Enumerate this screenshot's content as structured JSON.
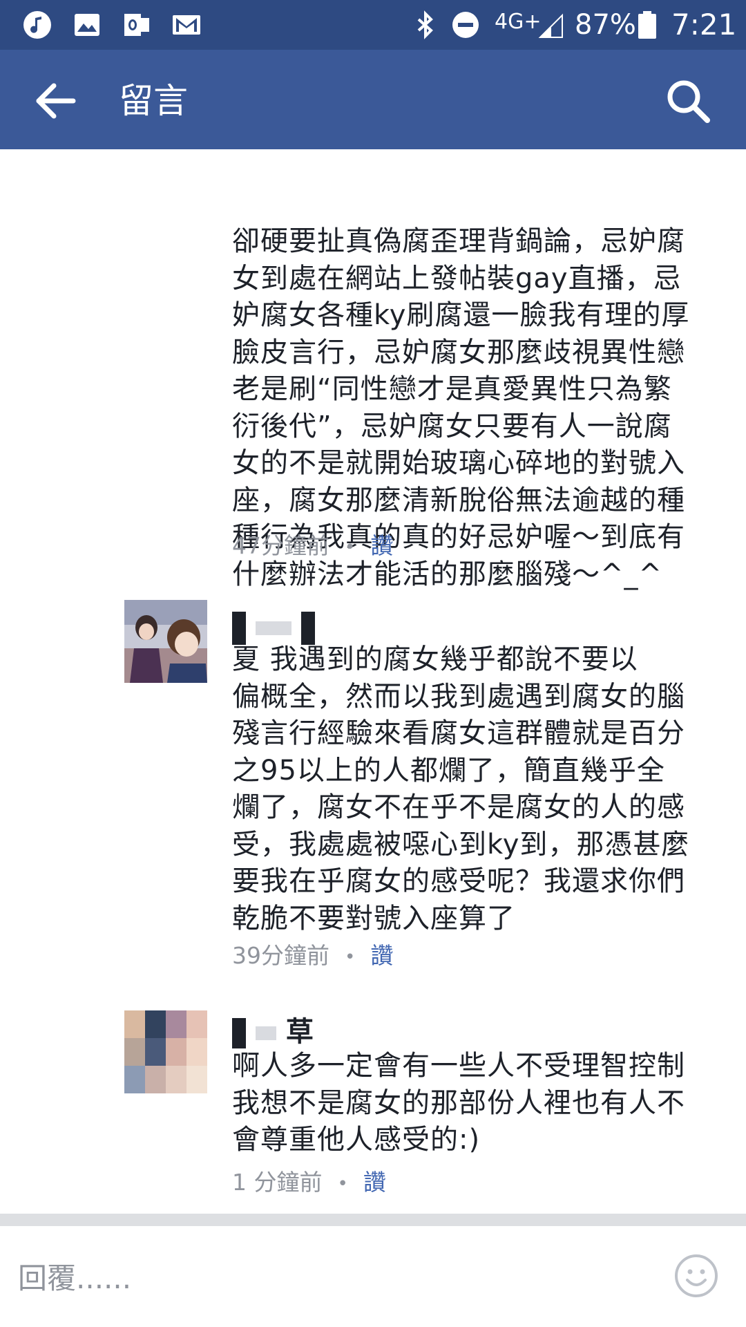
{
  "status_bar": {
    "network": "4G+",
    "battery": "87%",
    "time": "7:21",
    "left_icons": [
      "music-icon",
      "image-icon",
      "outlook-icon",
      "gmail-icon"
    ],
    "right_icons": [
      "bluetooth-icon",
      "do-not-disturb-icon",
      "signal-icon",
      "battery-icon"
    ]
  },
  "app_bar": {
    "title": "留言",
    "back_icon": "back-arrow-icon",
    "search_icon": "search-icon",
    "color": "#3b5998"
  },
  "comments": [
    {
      "partial_top": true,
      "text": "卻硬要扯真偽腐歪理背鍋論，忌妒腐\n女到處在網站上發帖裝gay直播，忌\n妒腐女各種ky刷腐還一臉我有理的厚\n臉皮言行，忌妒腐女那麼歧視異性戀\n老是刷“同性戀才是真愛異性只為繁\n衍後代”，忌妒腐女只要有人一說腐\n女的不是就開始玻璃心碎地的對號入\n座，腐女那麼清新脫俗無法逾越的種\n種行為我真的真的好忌妒喔～到底有\n什麼辦法才能活的那麼腦殘～^_^",
      "time": "47分鐘前",
      "like": "讚"
    },
    {
      "author": "夏",
      "text": "夏 我遇到的腐女幾乎都說不要以\n偏概全，然而以我到處遇到腐女的腦\n殘言行經驗來看腐女這群體就是百分\n之95以上的人都爛了，簡直幾乎全\n爛了，腐女不在乎不是腐女的人的感\n受，我處處被噁心到ky到，那憑甚麼\n要我在乎腐女的感受呢？我還求你們\n乾脆不要對號入座算了",
      "time": "39分鐘前",
      "like": "讚"
    },
    {
      "author": "草",
      "text": "啊人多一定會有一些人不受理智控制\n我想不是腐女的那部份人裡也有人不\n會尊重他人感受的:)",
      "time": "1 分鐘前",
      "like": "讚"
    }
  ],
  "meta_separator": "•",
  "reply_bar": {
    "placeholder": "回覆......",
    "emoji_icon": "smiley-icon"
  }
}
